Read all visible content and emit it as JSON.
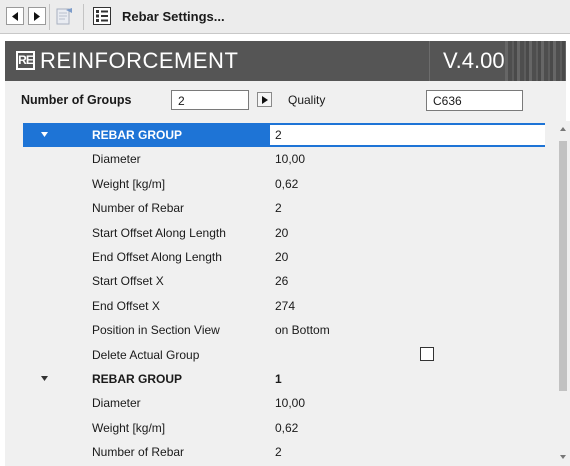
{
  "toolbar": {
    "title": "Rebar Settings..."
  },
  "banner": {
    "title": "REINFORCEMENT",
    "version": "V.4.00",
    "logo_text": "RE"
  },
  "groups": {
    "label": "Number of Groups",
    "value": "2",
    "quality_label": "Quality",
    "quality_value": "C636"
  },
  "rows": [
    {
      "label": "REBAR GROUP",
      "value": "2",
      "kind": "group",
      "selected": true
    },
    {
      "label": "Diameter",
      "value": "10,00"
    },
    {
      "label": "Weight [kg/m]",
      "value": "0,62"
    },
    {
      "label": "Number of Rebar",
      "value": "2"
    },
    {
      "label": "Start Offset Along Length",
      "value": "20"
    },
    {
      "label": "End Offset Along Length",
      "value": "20"
    },
    {
      "label": "Start Offset X",
      "value": "26"
    },
    {
      "label": "End Offset X",
      "value": "274"
    },
    {
      "label": "Position in Section View",
      "value": "on Bottom"
    },
    {
      "label": "Delete Actual Group",
      "value": "",
      "checkbox": true,
      "checked": false
    },
    {
      "label": "REBAR GROUP",
      "value": "1",
      "kind": "group"
    },
    {
      "label": "Diameter",
      "value": "10,00"
    },
    {
      "label": "Weight [kg/m]",
      "value": "0,62"
    },
    {
      "label": "Number of Rebar",
      "value": "2"
    },
    {
      "label": "Start Offset Along Length",
      "value": "20"
    }
  ],
  "colors": {
    "selection": "#1e74d6",
    "banner": "#555555"
  },
  "icons": [
    "back-arrow-icon",
    "forward-arrow-icon",
    "document-icon",
    "settings-list-icon",
    "collapse-triangle-icon",
    "scroll-up-icon",
    "scroll-down-icon"
  ]
}
